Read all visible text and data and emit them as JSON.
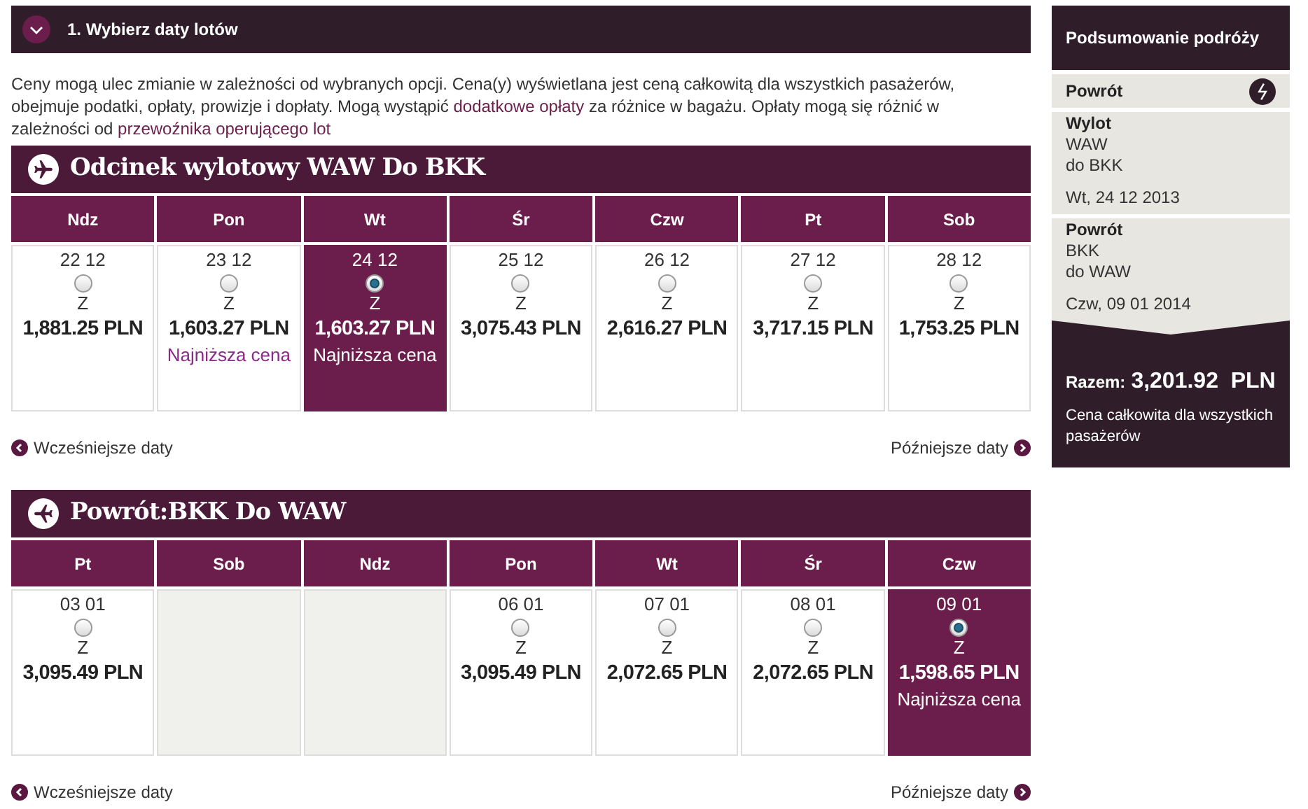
{
  "step_header": {
    "title": "1. Wybierz daty lotów",
    "expanded": true
  },
  "notice": "Ceny mogą ulec zmianie w zależności od wybranych opcji. Cena(y) wyświetlana jest ceną całkowitą dla wszystkich pasażerów, obejmuje podatki, opłaty, prowizje i dopłaty. Mogą wystąpić ",
  "notice_link_1": "dodatkowe opłaty",
  "notice_mid": " za różnice w bagażu. Opłaty mogą się różnić w zależności od ",
  "notice_link_2": "przewoźnika operującego lot",
  "segments": [
    {
      "title": "Odcinek wylotowy WAW Do BKK",
      "kind": "outbound",
      "days": [
        {
          "day": "Ndz",
          "kind": "fare",
          "date": "22 12",
          "selected": false,
          "fare_class": "Z",
          "price": "1,881.25 PLN"
        },
        {
          "day": "Pon",
          "kind": "fare",
          "date": "23 12",
          "selected": false,
          "fare_class": "Z",
          "price": "1,603.27 PLN",
          "note": "Najniższa cena"
        },
        {
          "day": "Wt",
          "kind": "fare",
          "date": "24 12",
          "selected": true,
          "fare_class": "Z",
          "price": "1,603.27 PLN",
          "note": "Najniższa cena"
        },
        {
          "day": "Śr",
          "kind": "fare",
          "date": "25 12",
          "selected": false,
          "fare_class": "Z",
          "price": "3,075.43 PLN"
        },
        {
          "day": "Czw",
          "kind": "fare",
          "date": "26 12",
          "selected": false,
          "fare_class": "Z",
          "price": "2,616.27 PLN"
        },
        {
          "day": "Pt",
          "kind": "fare",
          "date": "27 12",
          "selected": false,
          "fare_class": "Z",
          "price": "3,717.15 PLN"
        },
        {
          "day": "Sob",
          "kind": "fare",
          "date": "28 12",
          "selected": false,
          "fare_class": "Z",
          "price": "1,753.25 PLN"
        }
      ],
      "earlier": "Wcześniejsze daty",
      "later": "Późniejsze daty"
    },
    {
      "title": "Powrót:BKK Do WAW",
      "kind": "return",
      "days": [
        {
          "day": "Pt",
          "kind": "fare",
          "date": "03 01",
          "selected": false,
          "fare_class": "Z",
          "price": "3,095.49 PLN"
        },
        {
          "day": "Sob",
          "kind": "empty"
        },
        {
          "day": "Ndz",
          "kind": "empty"
        },
        {
          "day": "Pon",
          "kind": "fare",
          "date": "06 01",
          "selected": false,
          "fare_class": "Z",
          "price": "3,095.49 PLN"
        },
        {
          "day": "Wt",
          "kind": "fare",
          "date": "07 01",
          "selected": false,
          "fare_class": "Z",
          "price": "2,072.65 PLN"
        },
        {
          "day": "Śr",
          "kind": "fare",
          "date": "08 01",
          "selected": false,
          "fare_class": "Z",
          "price": "2,072.65 PLN"
        },
        {
          "day": "Czw",
          "kind": "fare",
          "date": "09 01",
          "selected": true,
          "fare_class": "Z",
          "price": "1,598.65 PLN",
          "note": "Najniższa cena"
        }
      ],
      "earlier": "Wcześniejsze daty",
      "later": "Późniejsze daty"
    }
  ],
  "summary": {
    "title": "Podsumowanie podróży",
    "trip_type": "Powrót",
    "legs": [
      {
        "label": "Wylot",
        "from": "WAW",
        "to": "do BKK",
        "date": "Wt, 24 12 2013"
      },
      {
        "label": "Powrót",
        "from": "BKK",
        "to": "do WAW",
        "date": "Czw, 09 01 2014"
      }
    ],
    "total_label": "Razem:",
    "total": "3,201.92  PLN",
    "total_note": "Cena całkowita dla wszystkich pasażerów"
  }
}
